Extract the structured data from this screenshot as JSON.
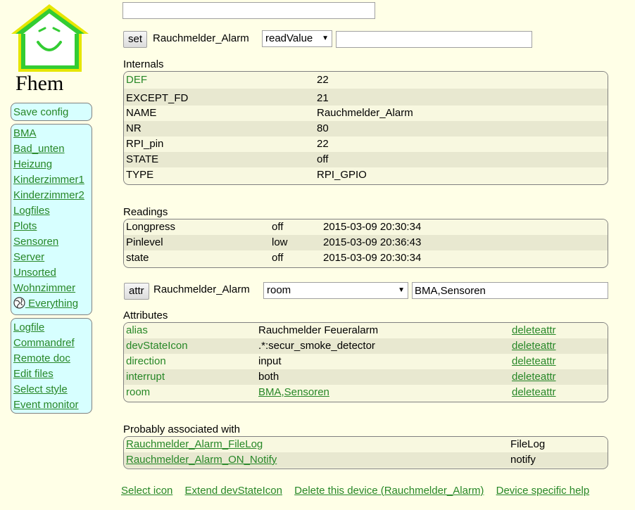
{
  "logo": {
    "text": "Fhem"
  },
  "sidebar": {
    "save_label": "Save config",
    "rooms": [
      "BMA",
      "Bad_unten",
      "Heizung",
      "Kinderzimmer1",
      "Kinderzimmer2",
      "Logfiles",
      "Plots",
      "Sensoren",
      "Server",
      "Unsorted",
      "Wohnzimmer"
    ],
    "everything_label": " Everything",
    "menu": [
      "Logfile",
      "Commandref",
      "Remote doc",
      "Edit files",
      "Select style",
      "Event monitor"
    ]
  },
  "top_input": {
    "value": ""
  },
  "set_row": {
    "button_label": "set",
    "device": "Rauchmelder_Alarm",
    "select_value": "readValue",
    "input_value": ""
  },
  "internals": {
    "title": "Internals",
    "rows": [
      {
        "name": "DEF",
        "value": "22"
      },
      {
        "name": "EXCEPT_FD",
        "value": "21"
      },
      {
        "name": "NAME",
        "value": "Rauchmelder_Alarm"
      },
      {
        "name": "NR",
        "value": "80"
      },
      {
        "name": "RPI_pin",
        "value": "22"
      },
      {
        "name": "STATE",
        "value": "off"
      },
      {
        "name": "TYPE",
        "value": "RPI_GPIO"
      }
    ]
  },
  "readings": {
    "title": "Readings",
    "rows": [
      {
        "name": "Longpress",
        "value": "off",
        "time": "2015-03-09 20:30:34"
      },
      {
        "name": "Pinlevel",
        "value": "low",
        "time": "2015-03-09 20:36:43"
      },
      {
        "name": "state",
        "value": "off",
        "time": "2015-03-09 20:30:34"
      }
    ]
  },
  "attr_row": {
    "button_label": "attr",
    "device": "Rauchmelder_Alarm",
    "select_value": "room",
    "input_value": "BMA,Sensoren"
  },
  "attributes": {
    "title": "Attributes",
    "delete_label": "deleteattr",
    "rows": [
      {
        "name": "alias",
        "value": "Rauchmelder Feueralarm"
      },
      {
        "name": "devStateIcon",
        "value": ".*:secur_smoke_detector"
      },
      {
        "name": "direction",
        "value": "input"
      },
      {
        "name": "interrupt",
        "value": "both"
      },
      {
        "name": "room",
        "value": "BMA,Sensoren"
      }
    ]
  },
  "associated": {
    "title": "Probably associated with",
    "rows": [
      {
        "name": "Rauchmelder_Alarm_FileLog",
        "type": "FileLog"
      },
      {
        "name": "Rauchmelder_Alarm_ON_Notify",
        "type": "notify"
      }
    ]
  },
  "bottom_links": [
    "Select icon",
    "Extend devStateIcon",
    "Delete this device (Rauchmelder_Alarm)",
    "Device specific help"
  ],
  "colors": {
    "background": "#FFFFE7",
    "link": "#278727",
    "sidebar": "#D7FFFF",
    "logo_house": "#33CC33",
    "logo_outline": "#E6E600"
  }
}
